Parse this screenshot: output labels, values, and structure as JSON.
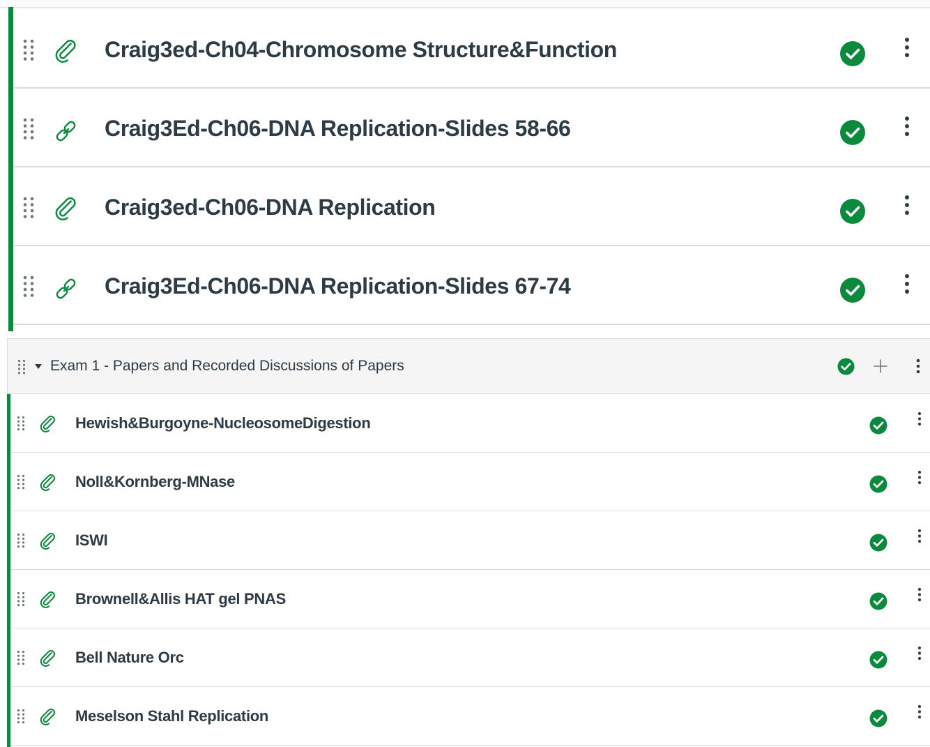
{
  "colors": {
    "published_green": "#0b8a3d",
    "text": "#2d3b45",
    "icon_gray": "#6b7780",
    "divider": "#d9dcde",
    "header_bg": "#f5f5f5"
  },
  "upper_module": {
    "items": [
      {
        "title": "Craig3ed-Ch04-Chromosome Structure&Function",
        "icon": "attachment-icon",
        "status": "published"
      },
      {
        "title": "Craig3Ed-Ch06-DNA Replication-Slides 58-66",
        "icon": "link-icon",
        "status": "published"
      },
      {
        "title": "Craig3ed-Ch06-DNA Replication",
        "icon": "attachment-icon",
        "status": "published"
      },
      {
        "title": "Craig3Ed-Ch06-DNA Replication-Slides 67-74",
        "icon": "link-icon",
        "status": "published"
      }
    ]
  },
  "exam_module": {
    "title": "Exam 1 - Papers and Recorded Discussions of Papers",
    "status": "published",
    "expanded": true,
    "items": [
      {
        "title": "Hewish&Burgoyne-NucleosomeDigestion",
        "icon": "attachment-icon",
        "status": "published"
      },
      {
        "title": "Noll&Kornberg-MNase",
        "icon": "attachment-icon",
        "status": "published"
      },
      {
        "title": "ISWI",
        "icon": "attachment-icon",
        "status": "published"
      },
      {
        "title": "Brownell&Allis HAT gel PNAS",
        "icon": "attachment-icon",
        "status": "published"
      },
      {
        "title": "Bell Nature Orc",
        "icon": "attachment-icon",
        "status": "published"
      },
      {
        "title": "Meselson Stahl Replication",
        "icon": "attachment-icon",
        "status": "published"
      }
    ]
  }
}
